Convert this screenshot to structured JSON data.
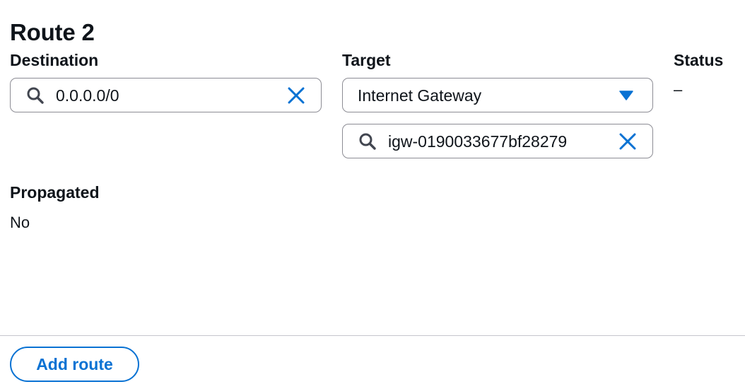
{
  "route": {
    "title": "Route 2",
    "destination": {
      "label": "Destination",
      "value": "0.0.0.0/0",
      "icon": "search-icon",
      "clear_icon": "close-icon"
    },
    "target": {
      "label": "Target",
      "selected": "Internet Gateway",
      "caret_icon": "caret-down-icon",
      "gateway_value": "igw-0190033677bf28279"
    },
    "status": {
      "label": "Status",
      "value": "–"
    },
    "propagated": {
      "label": "Propagated",
      "value": "No"
    }
  },
  "footer": {
    "add_route_label": "Add route"
  },
  "colors": {
    "accent": "#0972d3",
    "text": "#0f141a",
    "border": "#8c8c94",
    "icon_gray": "#424650"
  }
}
